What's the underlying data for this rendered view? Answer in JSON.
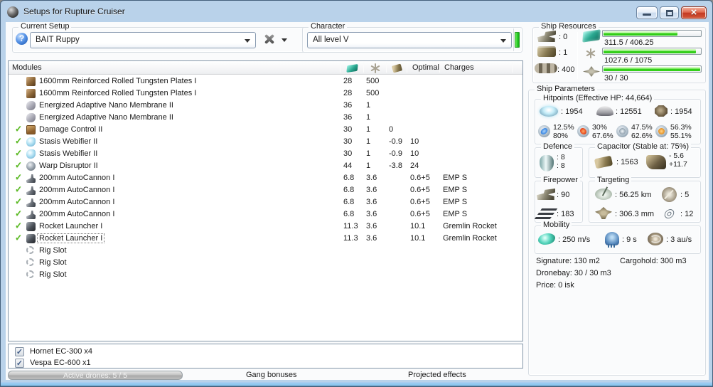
{
  "window": {
    "title": "Setups for Rupture Cruiser"
  },
  "colors": {
    "bar_green": "#3ad41e",
    "indicator_green": "#22cc22",
    "close_red": "#c33a22"
  },
  "current_setup": {
    "label": "Current Setup",
    "value": "BAIT Ruppy"
  },
  "character": {
    "label": "Character",
    "value": "All level V"
  },
  "modules_table": {
    "header": {
      "name": "Modules",
      "optimal": "Optimal",
      "charges": "Charges"
    },
    "rows": [
      {
        "checked": false,
        "selected": false,
        "icon": "armor-plate",
        "name": "1600mm Reinforced Rolled Tungsten Plates I",
        "cpu": "28",
        "pg": "500",
        "cap": "",
        "optimal": "",
        "charges": ""
      },
      {
        "checked": false,
        "selected": false,
        "icon": "armor-plate",
        "name": "1600mm Reinforced Rolled Tungsten Plates I",
        "cpu": "28",
        "pg": "500",
        "cap": "",
        "optimal": "",
        "charges": ""
      },
      {
        "checked": false,
        "selected": false,
        "icon": "nano-membrane",
        "name": "Energized Adaptive Nano Membrane II",
        "cpu": "36",
        "pg": "1",
        "cap": "",
        "optimal": "",
        "charges": ""
      },
      {
        "checked": false,
        "selected": false,
        "icon": "nano-membrane",
        "name": "Energized Adaptive Nano Membrane II",
        "cpu": "36",
        "pg": "1",
        "cap": "",
        "optimal": "",
        "charges": ""
      },
      {
        "checked": true,
        "selected": false,
        "icon": "damage-control",
        "name": "Damage Control II",
        "cpu": "30",
        "pg": "1",
        "cap": "0",
        "optimal": "",
        "charges": ""
      },
      {
        "checked": true,
        "selected": false,
        "icon": "stasis-web",
        "name": "Stasis Webifier II",
        "cpu": "30",
        "pg": "1",
        "cap": "-0.9",
        "optimal": "10",
        "charges": ""
      },
      {
        "checked": true,
        "selected": false,
        "icon": "stasis-web",
        "name": "Stasis Webifier II",
        "cpu": "30",
        "pg": "1",
        "cap": "-0.9",
        "optimal": "10",
        "charges": ""
      },
      {
        "checked": true,
        "selected": false,
        "icon": "warp-disruptor",
        "name": "Warp Disruptor II",
        "cpu": "44",
        "pg": "1",
        "cap": "-3.8",
        "optimal": "24",
        "charges": ""
      },
      {
        "checked": true,
        "selected": false,
        "icon": "autocannon",
        "name": "200mm AutoCannon I",
        "cpu": "6.8",
        "pg": "3.6",
        "cap": "",
        "optimal": "0.6+5",
        "charges": "EMP S"
      },
      {
        "checked": true,
        "selected": false,
        "icon": "autocannon",
        "name": "200mm AutoCannon I",
        "cpu": "6.8",
        "pg": "3.6",
        "cap": "",
        "optimal": "0.6+5",
        "charges": "EMP S"
      },
      {
        "checked": true,
        "selected": false,
        "icon": "autocannon",
        "name": "200mm AutoCannon I",
        "cpu": "6.8",
        "pg": "3.6",
        "cap": "",
        "optimal": "0.6+5",
        "charges": "EMP S"
      },
      {
        "checked": true,
        "selected": false,
        "icon": "autocannon",
        "name": "200mm AutoCannon I",
        "cpu": "6.8",
        "pg": "3.6",
        "cap": "",
        "optimal": "0.6+5",
        "charges": "EMP S"
      },
      {
        "checked": true,
        "selected": false,
        "icon": "rocket-launcher",
        "name": "Rocket Launcher I",
        "cpu": "11.3",
        "pg": "3.6",
        "cap": "",
        "optimal": "10.1",
        "charges": "Gremlin Rocket"
      },
      {
        "checked": true,
        "selected": true,
        "icon": "rocket-launcher",
        "name": "Rocket Launcher I",
        "cpu": "11.3",
        "pg": "3.6",
        "cap": "",
        "optimal": "10.1",
        "charges": "Gremlin Rocket"
      },
      {
        "checked": false,
        "selected": false,
        "icon": "rig-slot",
        "name": "Rig Slot",
        "cpu": "",
        "pg": "",
        "cap": "",
        "optimal": "",
        "charges": ""
      },
      {
        "checked": false,
        "selected": false,
        "icon": "rig-slot",
        "name": "Rig Slot",
        "cpu": "",
        "pg": "",
        "cap": "",
        "optimal": "",
        "charges": ""
      },
      {
        "checked": false,
        "selected": false,
        "icon": "rig-slot",
        "name": "Rig Slot",
        "cpu": "",
        "pg": "",
        "cap": "",
        "optimal": "",
        "charges": ""
      }
    ]
  },
  "drones": {
    "items": [
      {
        "label": "Hornet EC-300 x4",
        "checked": true
      },
      {
        "label": "Vespa EC-600 x1",
        "checked": true
      }
    ]
  },
  "bottom": {
    "active_drones": "Active drones: 5 / 5",
    "gang_bonuses": "Gang bonuses",
    "projected_effects": "Projected effects"
  },
  "ship_resources": {
    "label": "Ship Resources",
    "turrets": ": 0",
    "launchers": ": 1",
    "calibration": ": 400",
    "cpu": {
      "text": "311.5 / 406.25",
      "pct": 76.7
    },
    "powergrid": {
      "text": "1027.6 / 1075",
      "pct": 95.6
    },
    "dronebay": {
      "text": "30 / 30",
      "pct": 100
    }
  },
  "ship_parameters": {
    "label": "Ship Parameters",
    "hitpoints": {
      "label": "Hitpoints (Effective HP: 44,664)",
      "shield": ": 1954",
      "armor": ": 12551",
      "structure": ": 1954",
      "resists": [
        {
          "type": "em",
          "top": "12.5%",
          "bottom": "80%"
        },
        {
          "type": "thermal",
          "top": "30%",
          "bottom": "67.6%"
        },
        {
          "type": "kinetic",
          "top": "47.5%",
          "bottom": "62.6%"
        },
        {
          "type": "explosive",
          "top": "56.3%",
          "bottom": "55.1%"
        }
      ]
    },
    "defence": {
      "label": "Defence",
      "top": ": 8",
      "bottom": ": 8"
    },
    "capacitor": {
      "label": "Capacitor (Stable at: 75%)",
      "amount": ": 1563",
      "drain": "- 5.6",
      "recharge": "+11.7"
    },
    "firepower": {
      "label": "Firepower",
      "turret": ": 90",
      "missile": ": 183"
    },
    "targeting": {
      "label": "Targeting",
      "range": ": 56.25 km",
      "max_targets": ": 5",
      "scan_res": ": 306.3 mm",
      "sensor": ": 12"
    },
    "mobility": {
      "label": "Mobility",
      "speed": ": 250 m/s",
      "agility": ": 9 s",
      "warp": ": 3 au/s"
    },
    "stats": {
      "signature": "Signature: 130 m2",
      "cargohold": "Cargohold: 300 m3",
      "dronebay": "Dronebay: 30 / 30 m3",
      "price": "Price: 0 isk"
    }
  }
}
